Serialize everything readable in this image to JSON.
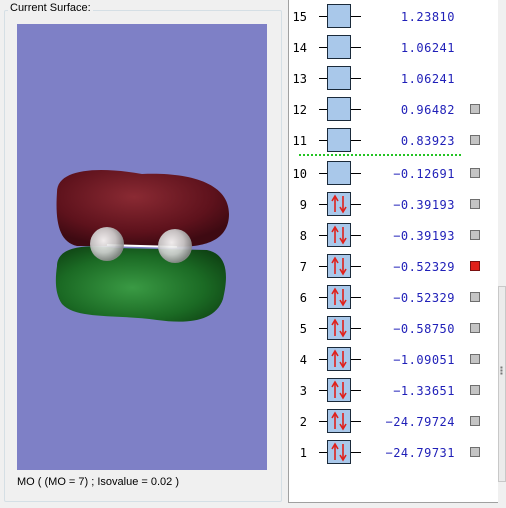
{
  "window": {
    "group_title": "Current Surface:",
    "status_text": "MO ( (MO = 7) ; Isovalue = 0.02 )"
  },
  "scene": {
    "background_color": "#7e80c6",
    "positive_lobe_color": "#6b1420",
    "negative_lobe_color": "#1c6a24",
    "atom_color": "#d8d8d8"
  },
  "mo_list": {
    "occupied_icon": "spin-pair-arrows-icon",
    "homo_lumo_separator_color": "#22c422",
    "selected_color": "#e0201a",
    "items": [
      {
        "number": "15",
        "energy": "1.23810",
        "occupied": false,
        "has_checkbox": false,
        "selected": false
      },
      {
        "number": "14",
        "energy": "1.06241",
        "occupied": false,
        "has_checkbox": false,
        "selected": false
      },
      {
        "number": "13",
        "energy": "1.06241",
        "occupied": false,
        "has_checkbox": false,
        "selected": false
      },
      {
        "number": "12",
        "energy": "0.96482",
        "occupied": false,
        "has_checkbox": true,
        "selected": false
      },
      {
        "number": "11",
        "energy": "0.83923",
        "occupied": false,
        "has_checkbox": true,
        "selected": false
      },
      {
        "number": "10",
        "energy": "−0.12691",
        "occupied": false,
        "has_checkbox": true,
        "selected": false
      },
      {
        "number": "9",
        "energy": "−0.39193",
        "occupied": true,
        "has_checkbox": true,
        "selected": false
      },
      {
        "number": "8",
        "energy": "−0.39193",
        "occupied": true,
        "has_checkbox": true,
        "selected": false
      },
      {
        "number": "7",
        "energy": "−0.52329",
        "occupied": true,
        "has_checkbox": true,
        "selected": true
      },
      {
        "number": "6",
        "energy": "−0.52329",
        "occupied": true,
        "has_checkbox": true,
        "selected": false
      },
      {
        "number": "5",
        "energy": "−0.58750",
        "occupied": true,
        "has_checkbox": true,
        "selected": false
      },
      {
        "number": "4",
        "energy": "−1.09051",
        "occupied": true,
        "has_checkbox": true,
        "selected": false
      },
      {
        "number": "3",
        "energy": "−1.33651",
        "occupied": true,
        "has_checkbox": true,
        "selected": false
      },
      {
        "number": "2",
        "energy": "−24.79724",
        "occupied": true,
        "has_checkbox": true,
        "selected": false
      },
      {
        "number": "1",
        "energy": "−24.79731",
        "occupied": true,
        "has_checkbox": true,
        "selected": false
      }
    ]
  }
}
